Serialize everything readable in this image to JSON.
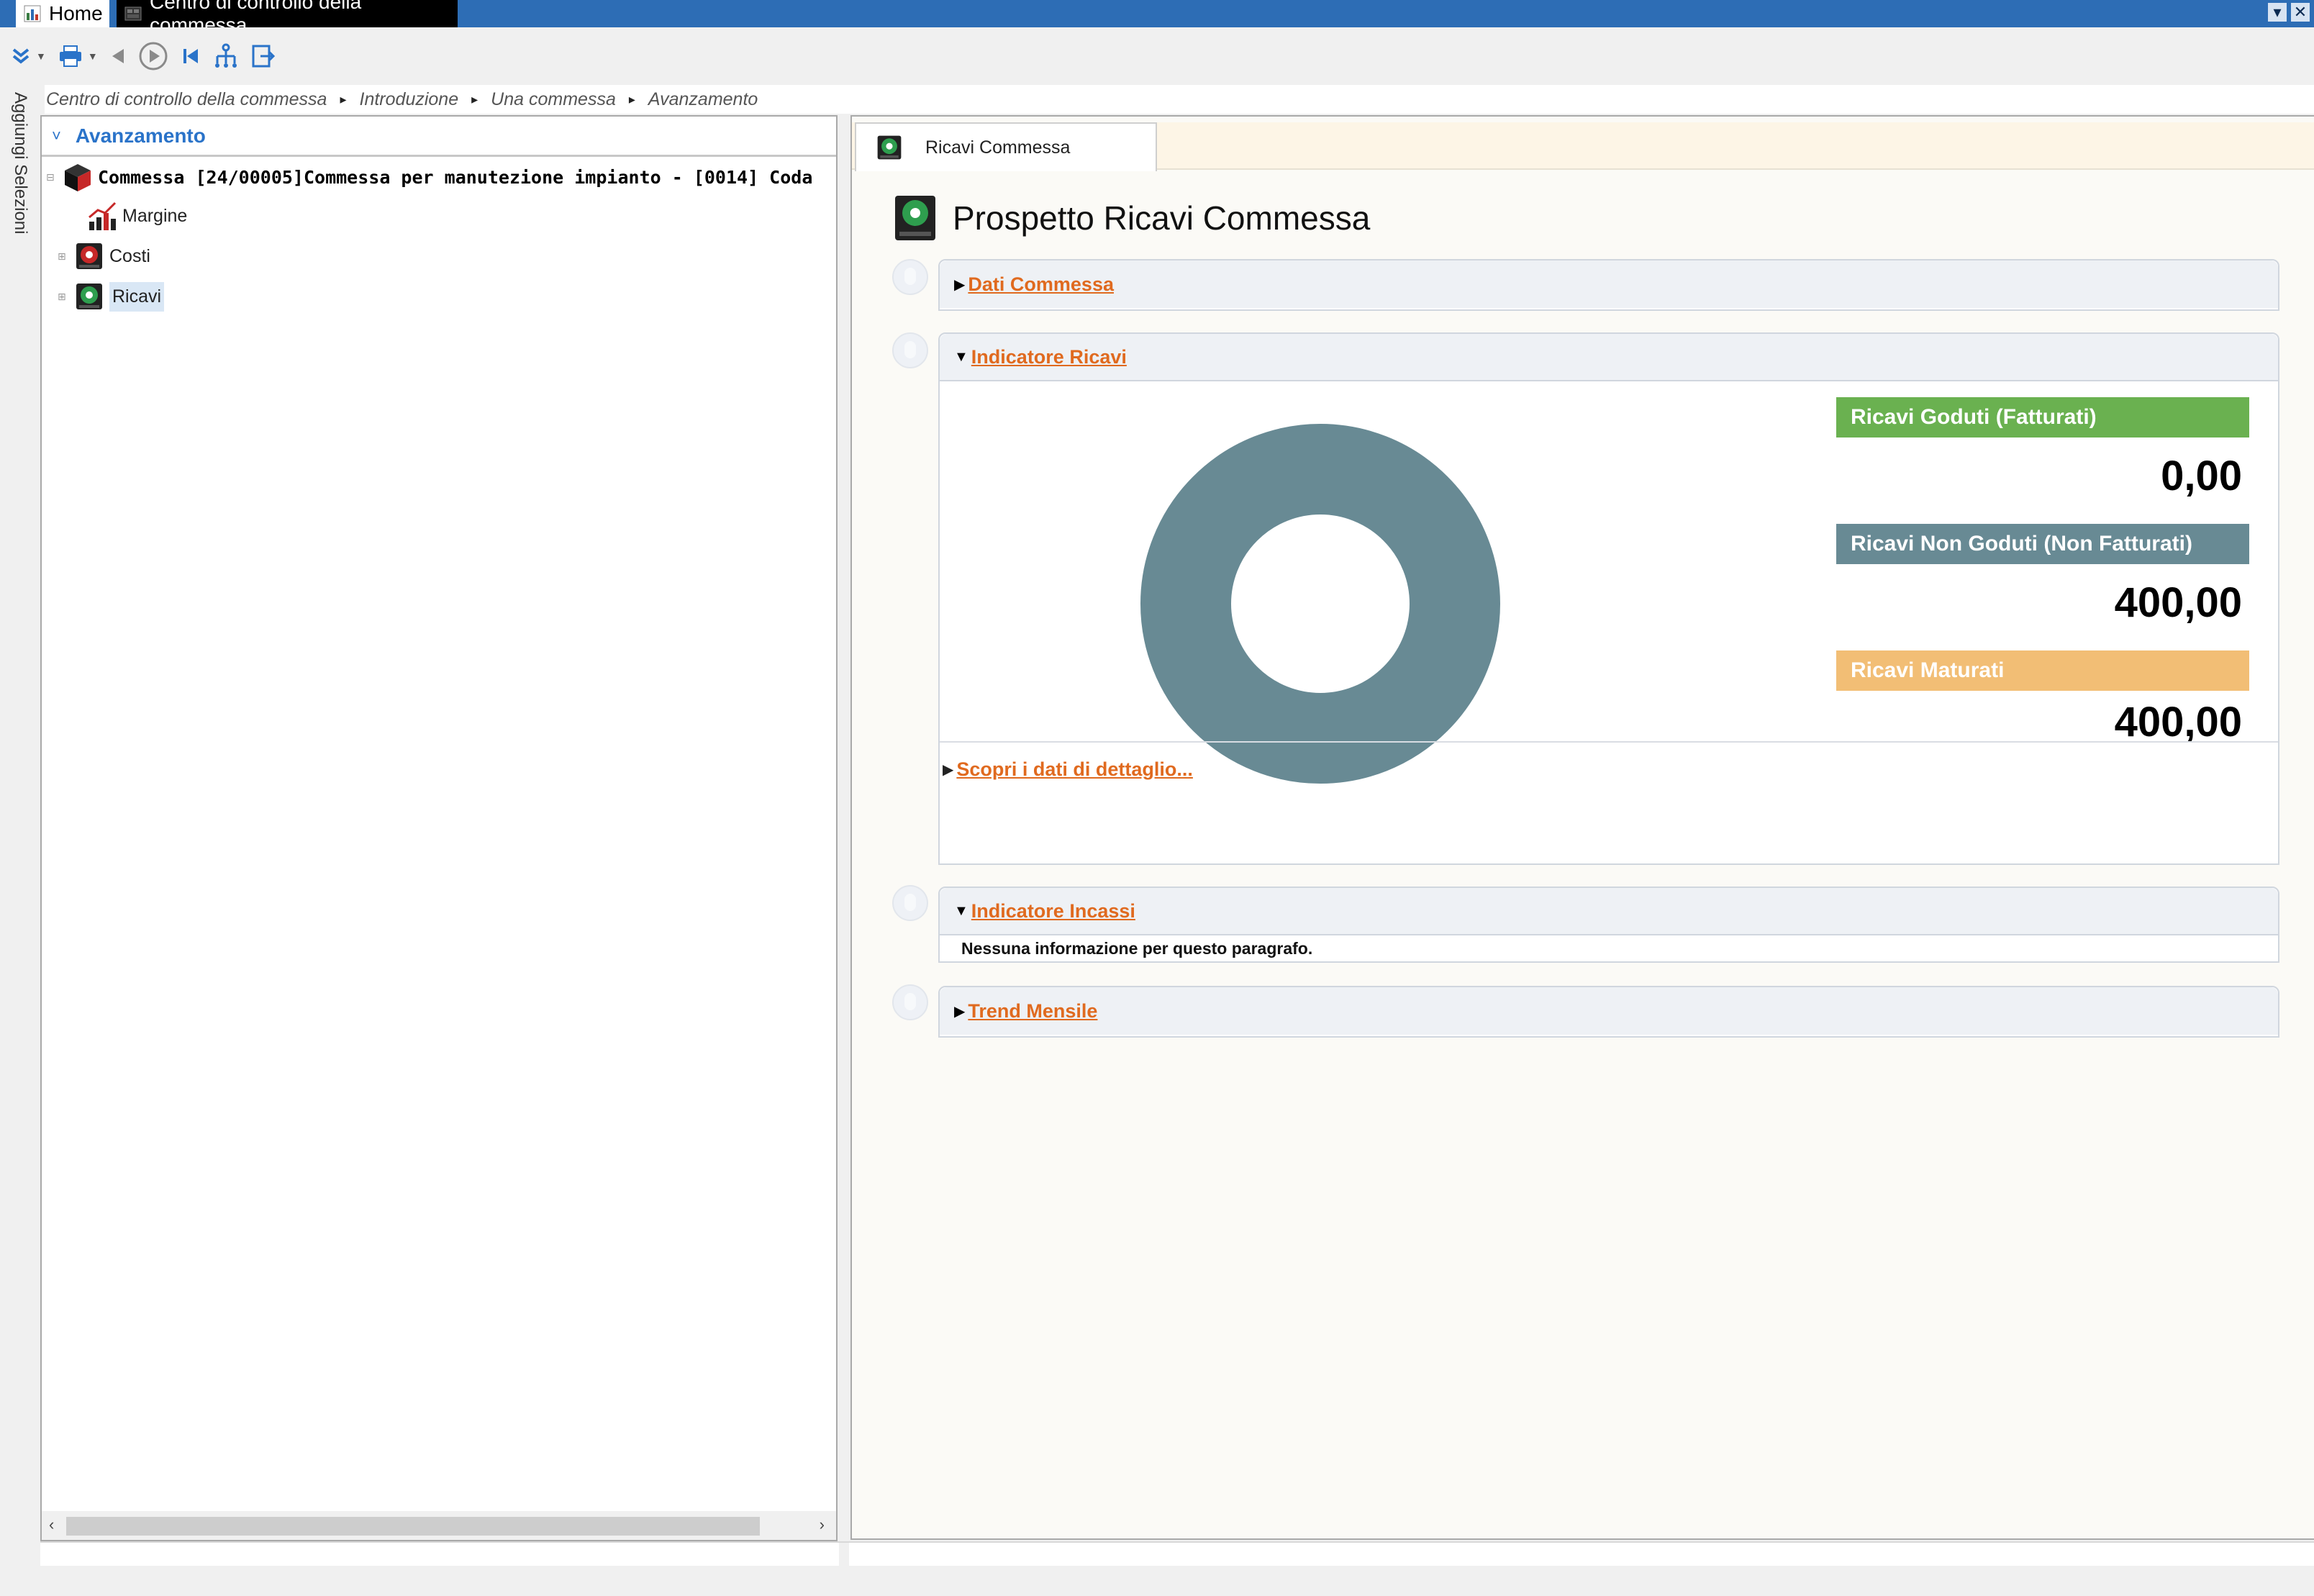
{
  "window": {
    "tabs": [
      {
        "label": "Home"
      },
      {
        "label": "Centro di controllo della commessa"
      }
    ],
    "controls": {
      "dropdown": "▾",
      "close": "✕"
    }
  },
  "toolbar": {
    "icons": [
      "expand-double-chevron-icon",
      "print-icon",
      "back-arrow-icon",
      "play-icon",
      "first-page-icon",
      "hierarchy-icon",
      "exit-icon"
    ]
  },
  "breadcrumb": {
    "items": [
      "Centro di controllo della commessa",
      "Introduzione",
      "Una commessa",
      "Avanzamento"
    ],
    "separator": "▸"
  },
  "siderail": {
    "label": "Aggiungi Selezioni"
  },
  "tree_panel": {
    "title": "Avanzamento",
    "collapse_glyph": "˅",
    "root": {
      "label": "Commessa [24/00005]Commessa per manutezione impianto - [0014] Coda"
    },
    "children": [
      {
        "label": "Margine"
      },
      {
        "label": "Costi"
      },
      {
        "label": "Ricavi",
        "selected": true
      }
    ],
    "scroll": {
      "left": "‹",
      "right": "›"
    }
  },
  "content": {
    "tab_label": "Ricavi Commessa",
    "page_title": "Prospetto Ricavi Commessa",
    "sections": {
      "dati": {
        "title": "Dati Commessa",
        "expanded": false
      },
      "indicatore_ricavi": {
        "title": "Indicatore Ricavi",
        "expanded": true
      },
      "indicatore_incassi": {
        "title": "Indicatore Incassi",
        "expanded": true,
        "message": "Nessuna informazione per questo paragrafo."
      },
      "trend": {
        "title": "Trend Mensile",
        "expanded": false
      }
    },
    "detail_link": "Scopri i dati di dettaglio...",
    "legend": [
      {
        "label": "Ricavi Goduti (Fatturati)",
        "value": "0,00",
        "color": "#6ab150"
      },
      {
        "label": "Ricavi Non Goduti (Non Fatturati)",
        "value": "400,00",
        "color": "#688a94"
      },
      {
        "label": "Ricavi Maturati",
        "value": "400,00",
        "color": "#f2be75"
      }
    ],
    "glyph_collapsed": "▶",
    "glyph_expanded": "▼"
  },
  "chart_data": {
    "type": "pie",
    "categories": [
      "Ricavi Goduti (Fatturati)",
      "Ricavi Non Goduti (Non Fatturati)"
    ],
    "values": [
      0,
      400
    ],
    "colors": [
      "#6ab150",
      "#688a94"
    ],
    "donut": true
  },
  "colors": {
    "titlebar": "#2d6db5",
    "accent_link": "#e06a1f",
    "tree_title": "#2a73c9"
  }
}
